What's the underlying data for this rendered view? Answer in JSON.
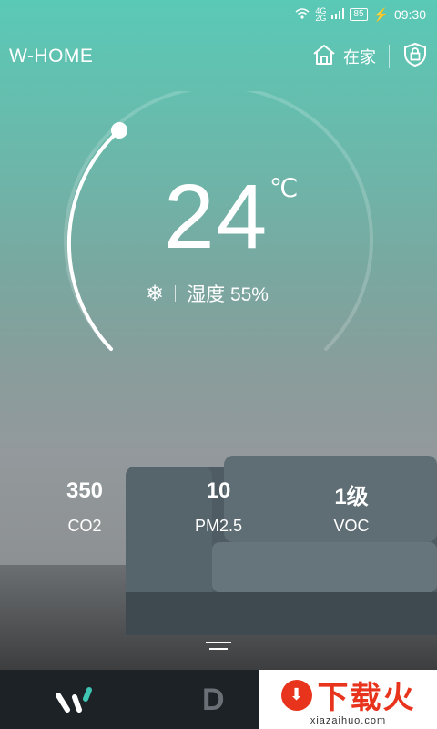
{
  "status_bar": {
    "signal": "4G\n2G",
    "battery": "85",
    "time": "09:30"
  },
  "header": {
    "brand": "W-HOME",
    "mode_label": "在家"
  },
  "climate": {
    "temperature": "24",
    "unit": "℃",
    "humidity": "湿度 55%",
    "dial_level": 0.02
  },
  "stats": [
    {
      "value": "350",
      "label": "CO2"
    },
    {
      "value": "10",
      "label": "PM2.5"
    },
    {
      "value": "1级",
      "label": "VOC"
    }
  ],
  "tabbar": {
    "tab2_glyph": "D"
  },
  "watermark": {
    "text": "下载火",
    "url": "xiazaihuo.com"
  }
}
